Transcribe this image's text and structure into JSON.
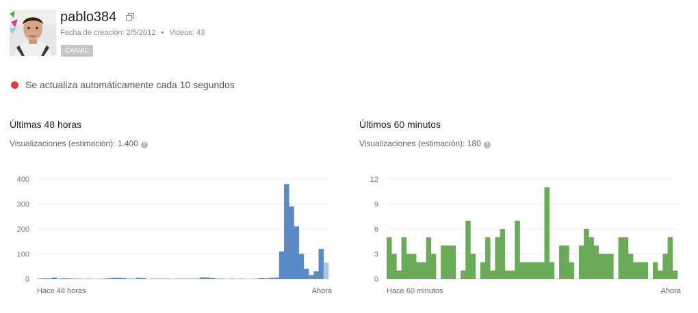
{
  "channel": {
    "name": "pablo384",
    "created_label": "Fecha de creación:",
    "created_date": "2/5/2012",
    "separator": "•",
    "videos_label": "Videos:",
    "videos_count": "43",
    "badge": "CANAL"
  },
  "live": {
    "text": "Se actualiza automáticamente cada 10 segundos",
    "color": "#d8414a"
  },
  "panels": {
    "left": {
      "title": "Últimas 48 horas",
      "views_label": "Visualizaciones (estimación): 1.400",
      "help_icon": "?"
    },
    "right": {
      "title": "Últimos 60 minutos",
      "views_label": "Visualizaciones (estimación): 180",
      "help_icon": "?"
    }
  },
  "chart_data": [
    {
      "type": "bar",
      "color": "#5b8bc7",
      "partial_color": "#aec6e6",
      "ylim": [
        0,
        400
      ],
      "yticks": [
        "0",
        "100",
        "200",
        "300",
        "400"
      ],
      "x_start_label": "Hace 48 horas",
      "x_end_label": "Ahora",
      "values": [
        1,
        2,
        2,
        5,
        1,
        2,
        2,
        1,
        1,
        0,
        1,
        0,
        0,
        1,
        2,
        4,
        4,
        3,
        1,
        1,
        4,
        3,
        0,
        1,
        1,
        1,
        1,
        0,
        1,
        1,
        1,
        1,
        1,
        6,
        5,
        3,
        1,
        1,
        0,
        1,
        0,
        1,
        0,
        0,
        1,
        3,
        2,
        4,
        5,
        110,
        380,
        290,
        210,
        100,
        40,
        15,
        30,
        120,
        65
      ],
      "partial_last": true
    },
    {
      "type": "bar",
      "color": "#6aaa58",
      "ylim": [
        0,
        12
      ],
      "yticks": [
        "0",
        "3",
        "6",
        "9",
        "12"
      ],
      "x_start_label": "Hace 60 minutos",
      "x_end_label": "Ahora",
      "values": [
        5,
        3,
        1,
        5,
        3,
        3,
        2,
        2,
        5,
        3,
        0,
        4,
        4,
        4,
        0,
        1,
        7,
        3,
        0,
        2,
        5,
        1,
        5,
        6,
        1,
        1,
        7,
        2,
        2,
        2,
        2,
        2,
        11,
        2,
        0,
        4,
        4,
        2,
        0,
        4,
        6,
        5,
        4,
        3,
        3,
        3,
        0,
        5,
        5,
        3,
        2,
        2,
        2,
        0,
        2,
        1,
        3,
        5,
        1
      ]
    }
  ],
  "icons": {
    "external": "external-link-icon",
    "help": "help-icon",
    "status": "live-status-dot"
  }
}
